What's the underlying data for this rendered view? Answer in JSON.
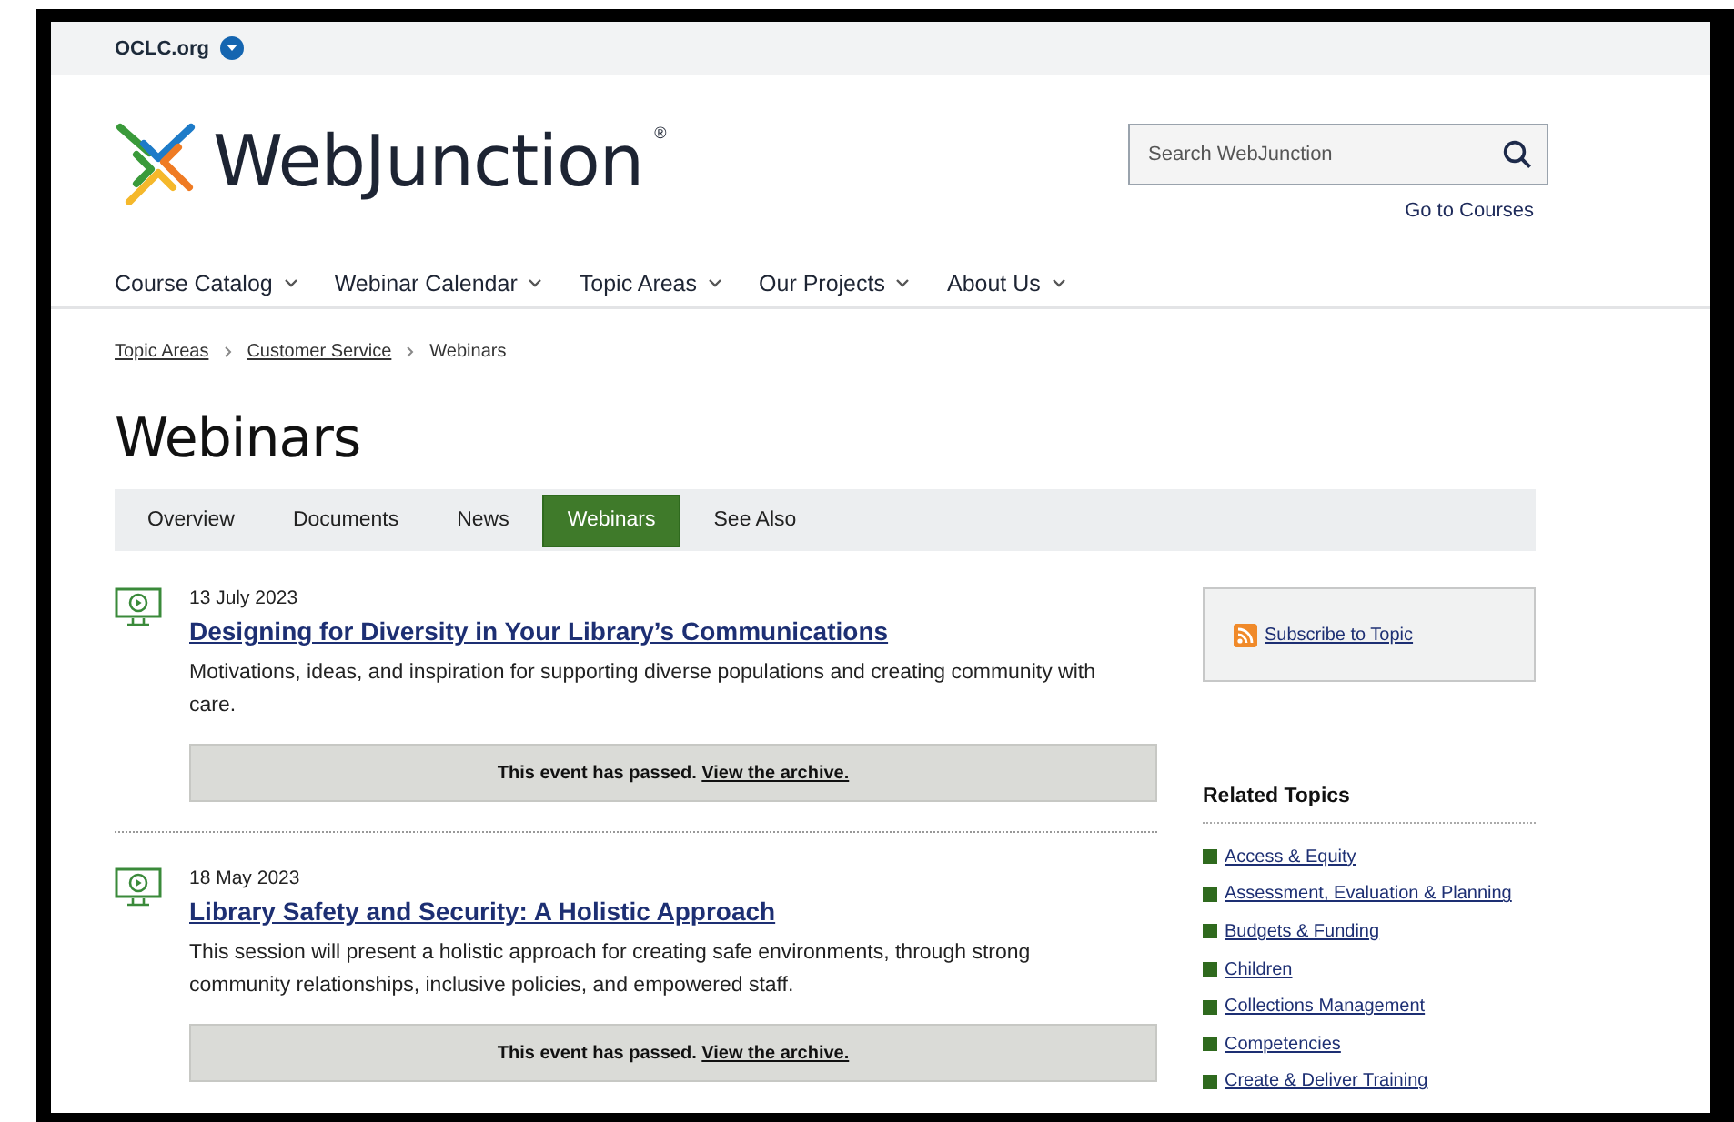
{
  "top_bar": {
    "link": "OCLC.org"
  },
  "logo": {
    "text": "WebJunction",
    "mark": "®"
  },
  "search": {
    "placeholder": "Search WebJunction"
  },
  "courses_link": "Go to Courses",
  "nav": [
    {
      "label": "Course Catalog"
    },
    {
      "label": "Webinar Calendar"
    },
    {
      "label": "Topic Areas"
    },
    {
      "label": "Our Projects"
    },
    {
      "label": "About Us"
    }
  ],
  "breadcrumb": [
    {
      "label": "Topic Areas",
      "link": true
    },
    {
      "label": "Customer Service",
      "link": true
    },
    {
      "label": "Webinars",
      "link": false
    }
  ],
  "page_title": "Webinars",
  "tabs": [
    {
      "label": "Overview",
      "selected": false
    },
    {
      "label": "Documents",
      "selected": false
    },
    {
      "label": "News",
      "selected": false
    },
    {
      "label": "Webinars",
      "selected": true
    },
    {
      "label": "See Also",
      "selected": false
    }
  ],
  "webinars": [
    {
      "date": "13 July 2023",
      "title": "Designing for Diversity in Your Library’s Communications",
      "description": "Motivations, ideas, and inspiration for supporting diverse populations and creating community with care.",
      "notice": "This event has passed.",
      "archive_link": "View the archive."
    },
    {
      "date": "18 May 2023",
      "title": "Library Safety and Security: A Holistic Approach",
      "description": "This session will present a holistic approach for creating safe environments, through strong community relationships, inclusive policies, and empowered staff.",
      "notice": "This event has passed.",
      "archive_link": "View the archive."
    }
  ],
  "subscribe_link": "Subscribe to Topic",
  "related_topics": {
    "heading": "Related Topics",
    "items": [
      "Access & Equity",
      "Assessment, Evaluation & Planning",
      "Budgets & Funding",
      "Children",
      "Collections Management",
      "Competencies",
      "Create & Deliver Training"
    ]
  }
}
